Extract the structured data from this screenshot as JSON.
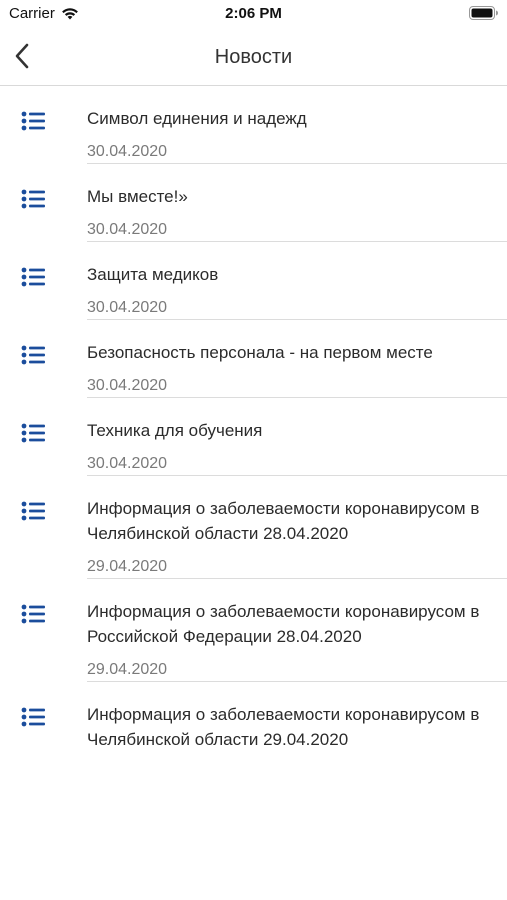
{
  "status_bar": {
    "carrier": "Carrier",
    "time": "2:06 PM"
  },
  "nav": {
    "title": "Новости",
    "back_icon": "chevron-left-icon"
  },
  "colors": {
    "accent": "#1b4d9c",
    "divider": "#dcdcdc",
    "date_text": "#7a7a7a"
  },
  "news": [
    {
      "title": "Символ единения и надежд",
      "date": "30.04.2020"
    },
    {
      "title": "Мы вместе!»",
      "date": "30.04.2020"
    },
    {
      "title": "Защита медиков",
      "date": "30.04.2020"
    },
    {
      "title": "Безопасность персонала - на первом месте",
      "date": "30.04.2020"
    },
    {
      "title": "Техника для обучения",
      "date": "30.04.2020"
    },
    {
      "title": "Информация о заболеваемости коронавирусом в Челябинской области 28.04.2020",
      "date": "29.04.2020"
    },
    {
      "title": "Информация о заболеваемости коронавирусом в Российской Федерации 28.04.2020",
      "date": "29.04.2020"
    },
    {
      "title": "Информация о заболеваемости коронавирусом в Челябинской области 29.04.2020",
      "date": ""
    }
  ]
}
